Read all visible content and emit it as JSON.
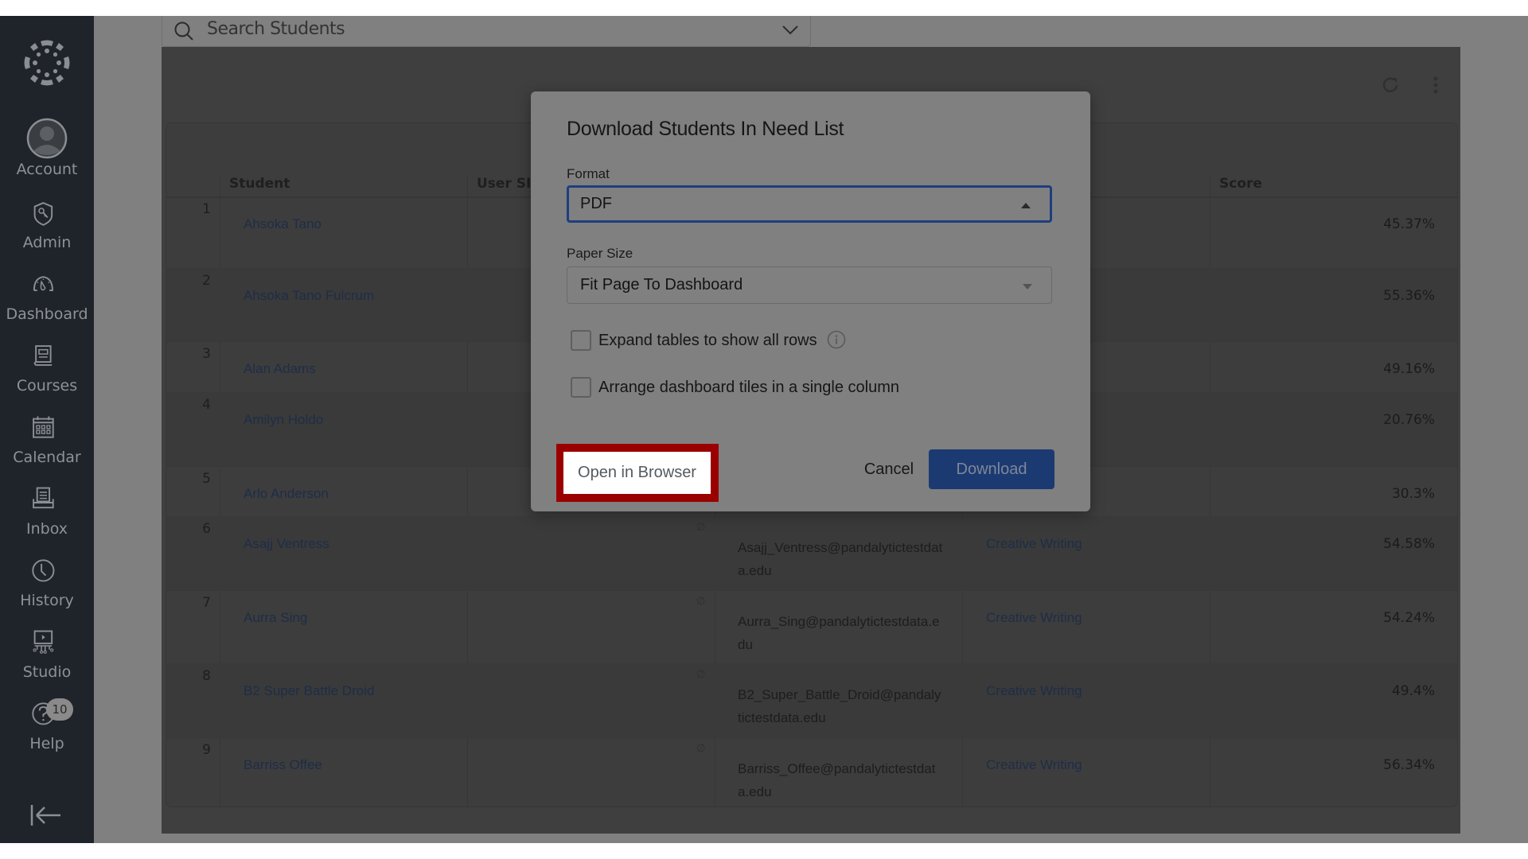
{
  "sidebar": {
    "items": [
      {
        "label": "Account",
        "icon": "account-icon"
      },
      {
        "label": "Admin",
        "icon": "admin-shield-icon"
      },
      {
        "label": "Dashboard",
        "icon": "dashboard-gauge-icon"
      },
      {
        "label": "Courses",
        "icon": "courses-book-icon"
      },
      {
        "label": "Calendar",
        "icon": "calendar-icon"
      },
      {
        "label": "Inbox",
        "icon": "inbox-icon"
      },
      {
        "label": "History",
        "icon": "history-clock-icon"
      },
      {
        "label": "Studio",
        "icon": "studio-icon"
      },
      {
        "label": "Help",
        "icon": "help-icon",
        "badge": "10"
      }
    ]
  },
  "search": {
    "placeholder": "Search Students"
  },
  "table": {
    "columns": [
      "Student",
      "User SIS",
      "",
      "",
      "Score"
    ],
    "rows": [
      {
        "num": "1",
        "student": "Ahsoka Tano",
        "sis": "",
        "email": "",
        "course": "",
        "score": "45.37%"
      },
      {
        "num": "2",
        "student": "Ahsoka Tano Fulcrum",
        "sis": "",
        "email": "",
        "course": "",
        "score": "55.36%"
      },
      {
        "num": "3",
        "student": "Alan Adams",
        "sis": "",
        "email": "",
        "course": "",
        "score": "49.16%"
      },
      {
        "num": "4",
        "student": "Amilyn Holdo",
        "sis": "",
        "email": "",
        "course": "",
        "score": "20.76%"
      },
      {
        "num": "5",
        "student": "Arlo Anderson",
        "sis": "",
        "email": "",
        "course": "",
        "score": "30.3%"
      },
      {
        "num": "6",
        "student": "Asajj Ventress",
        "sis": "∅",
        "email": "Asajj_Ventress@pandalytictestdata.edu",
        "course": "Creative Writing",
        "score": "54.58%"
      },
      {
        "num": "7",
        "student": "Aurra Sing",
        "sis": "∅",
        "email": "Aurra_Sing@pandalytictestdata.edu",
        "course": "Creative Writing",
        "score": "54.24%"
      },
      {
        "num": "8",
        "student": "B2 Super Battle Droid",
        "sis": "∅",
        "email": "B2_Super_Battle_Droid@pandalytictestdata.edu",
        "course": "Creative Writing",
        "score": "49.4%"
      },
      {
        "num": "9",
        "student": "Barriss Offee",
        "sis": "∅",
        "email": "Barriss_Offee@pandalytictestdata.edu",
        "course": "Creative Writing",
        "score": "56.34%"
      }
    ]
  },
  "modal": {
    "title": "Download Students In Need List",
    "format_label": "Format",
    "format_value": "PDF",
    "paper_label": "Paper Size",
    "paper_value": "Fit Page To Dashboard",
    "expand_label": "Expand tables to show all rows",
    "expand_checked": false,
    "arrange_label": "Arrange dashboard tiles in a single column",
    "arrange_checked": false,
    "open_browser_label": "Open in Browser",
    "cancel_label": "Cancel",
    "download_label": "Download"
  },
  "colors": {
    "sidebar_bg": "#1f242b",
    "primary_button": "#1c3a72",
    "highlight": "#9b0000",
    "link": "#1e2d47"
  }
}
